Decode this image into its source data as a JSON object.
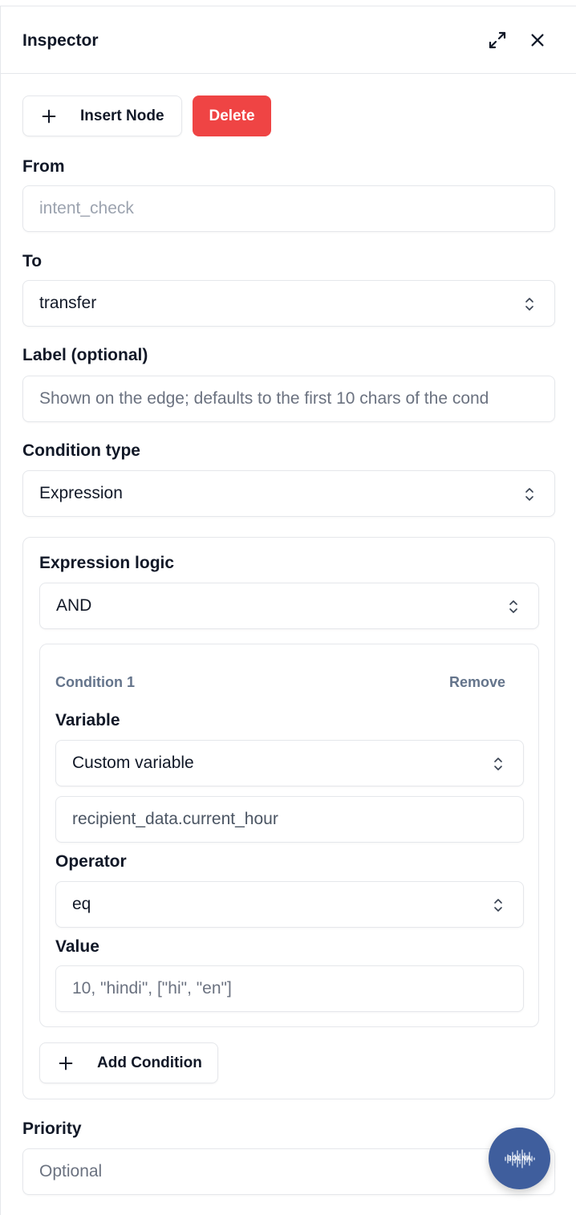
{
  "inspector": {
    "title": "Inspector",
    "insert_node_label": "Insert Node",
    "delete_label": "Delete"
  },
  "form": {
    "from_label": "From",
    "from_value": "intent_check",
    "to_label": "To",
    "to_value": "transfer",
    "edge_label_label": "Label (optional)",
    "edge_label_placeholder": "Shown on the edge; defaults to the first 10 chars of the cond",
    "condition_type_label": "Condition type",
    "condition_type_value": "Expression",
    "priority_label": "Priority",
    "priority_placeholder": "Optional"
  },
  "expression": {
    "logic_label": "Expression logic",
    "logic_value": "AND",
    "add_condition_label": "Add Condition",
    "conditions": [
      {
        "title": "Condition 1",
        "remove_label": "Remove",
        "variable_label": "Variable",
        "variable_select": "Custom variable",
        "variable_value": "recipient_data.current_hour",
        "operator_label": "Operator",
        "operator_value": "eq",
        "value_label": "Value",
        "value_placeholder": "10, \"hindi\", [\"hi\", \"en\"]"
      }
    ]
  },
  "fab": {
    "icon": "soundwave-logo-icon",
    "logo_text": "BOLNA",
    "color": "#3f5e9d"
  },
  "colors": {
    "danger": "#ef4444",
    "border": "#e5e7eb",
    "muted": "#64748b"
  }
}
